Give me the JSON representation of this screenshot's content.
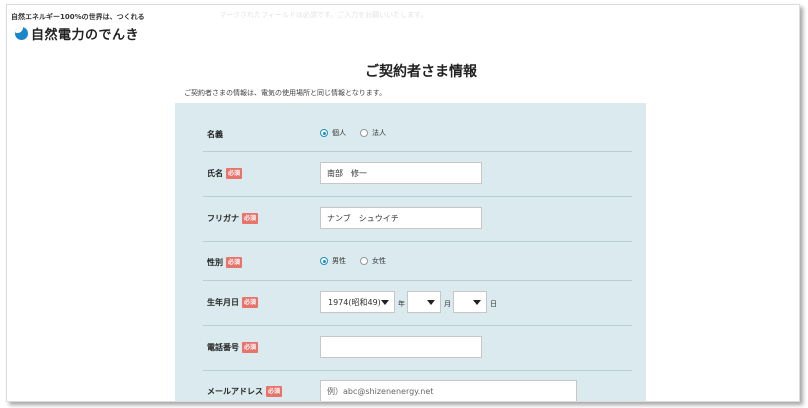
{
  "header": {
    "tagline": "自然エネルギー100%の世界は、つくれる",
    "logo_text": "自然電力のでんき",
    "faint_notice": "マークされたフィールドは必須です。ご入力をお願いいたします。"
  },
  "page": {
    "title": "ご契約者さま情報",
    "description": "ご契約者さまの情報は、電気の使用場所と同じ情報となります。"
  },
  "form": {
    "required_badge": "必須",
    "name_type": {
      "label": "名義",
      "options": [
        {
          "label": "個人",
          "checked": true
        },
        {
          "label": "法人",
          "checked": false
        }
      ]
    },
    "full_name": {
      "label": "氏名",
      "value": "南部　修一"
    },
    "furigana": {
      "label": "フリガナ",
      "value": "ナンブ　シュウイチ"
    },
    "gender": {
      "label": "性別",
      "options": [
        {
          "label": "男性",
          "checked": true
        },
        {
          "label": "女性",
          "checked": false
        }
      ]
    },
    "birthdate": {
      "label": "生年月日",
      "year_value": "1974(昭和49)",
      "year_unit": "年",
      "month_value": "",
      "month_unit": "月",
      "day_value": "",
      "day_unit": "日"
    },
    "phone": {
      "label": "電話番号",
      "value": ""
    },
    "email": {
      "label": "メールアドレス",
      "placeholder": "例）abc@shizenenergy.net",
      "value": ""
    }
  },
  "colors": {
    "panel_bg": "#daeaee",
    "required_badge": "#e8736b",
    "radio_accent": "#1a8fc8",
    "logo": "#1b87c9"
  }
}
